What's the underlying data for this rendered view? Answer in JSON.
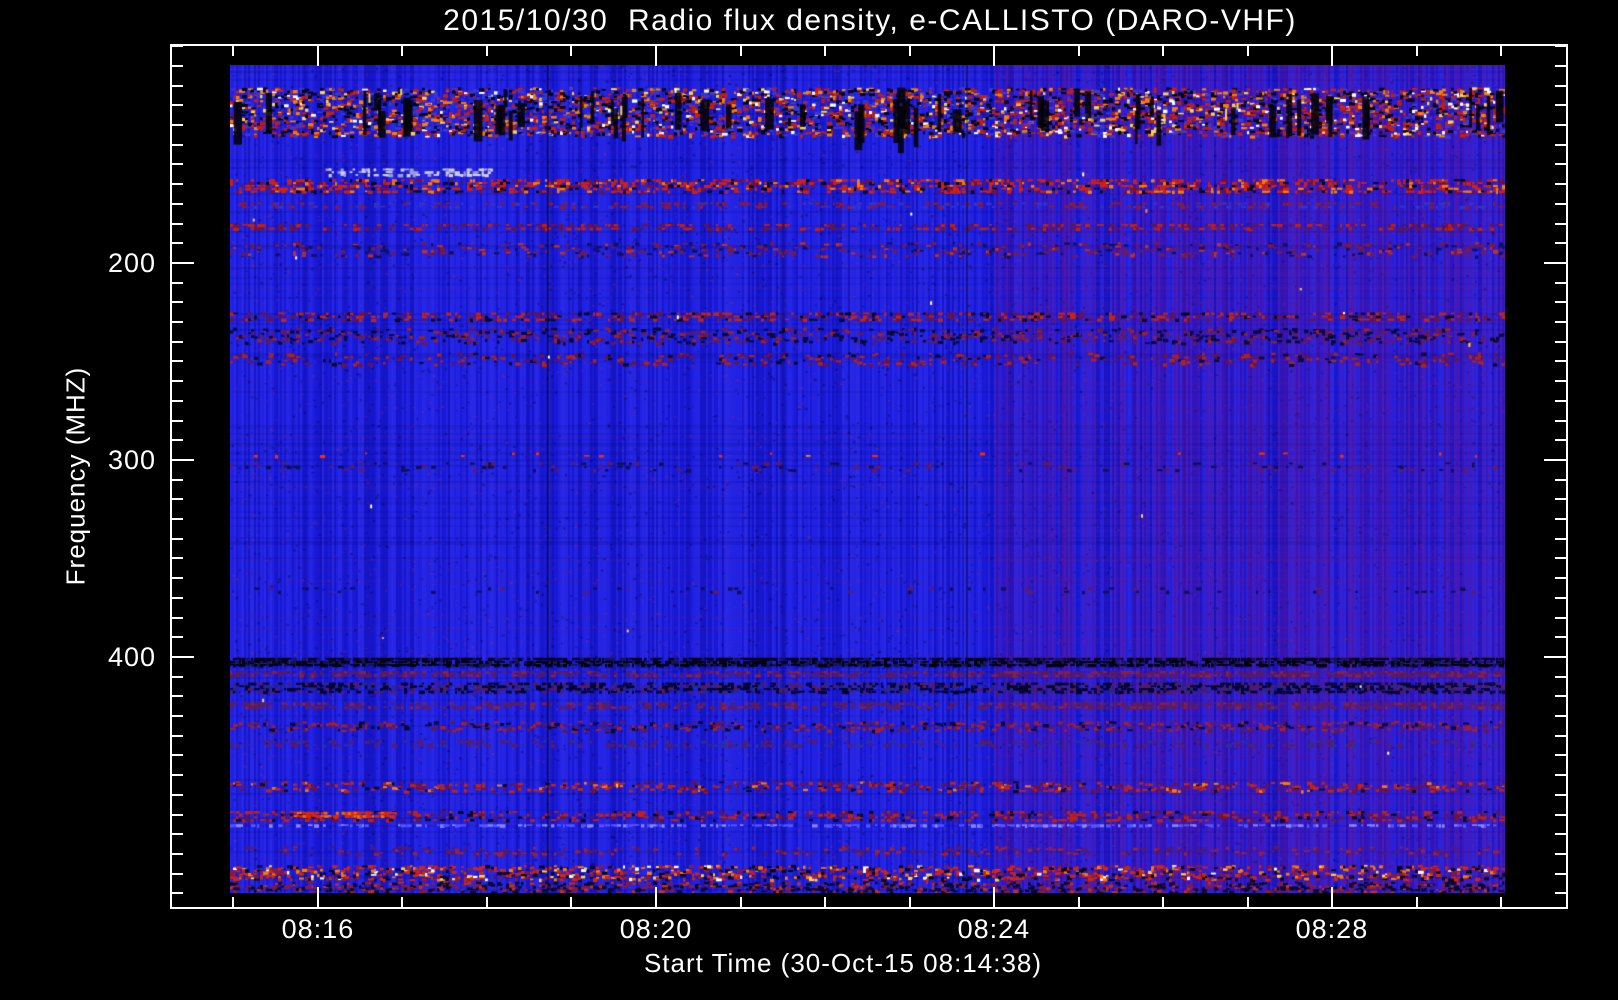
{
  "chart_data": {
    "type": "heatmap",
    "title": "2015/10/30  Radio flux density, e-CALLISTO (DARO-VHF)",
    "xlabel": "Start Time (30-Oct-15 08:14:38)",
    "ylabel": "Frequency (MHZ)",
    "start_time": "08:14:38",
    "date": "2015/10/30",
    "instrument": "e-CALLISTO (DARO-VHF)",
    "freq_range_mhz": [
      98,
      518
    ],
    "freq_axis_inverted": true,
    "x_axis": {
      "major_ticks": [
        {
          "label": "08:16",
          "frac": 0.1047
        },
        {
          "label": "08:20",
          "frac": 0.3472
        },
        {
          "label": "08:24",
          "frac": 0.5896
        },
        {
          "label": "08:28",
          "frac": 0.8321
        }
      ],
      "minor_start_frac": 0.0441,
      "minor_step_frac": 0.06062,
      "minor_count": 16,
      "minor_interval": "1 min"
    },
    "y_axis": {
      "major_ticks": [
        {
          "label": "200",
          "frac": 0.252
        },
        {
          "label": "300",
          "frac": 0.4808
        },
        {
          "label": "400",
          "frac": 0.7096
        }
      ],
      "minor_start_frac": 0.0003,
      "minor_step_frac": 0.02288,
      "minor_count": 44,
      "minor_interval": "10 MHz"
    },
    "colors": {
      "background": "#000000",
      "axis": "#ffffff",
      "base_blue": "#1c1ce0",
      "purple": "#5a1e8c",
      "band_red": "#c82010",
      "orange": "#ff7a00",
      "yellow": "#ffd24a",
      "dark": "#03031a",
      "white": "#ffffff"
    },
    "regimes": {
      "description": "background regime change at 08:24 - right side purple-tinted with vertical striping",
      "purple_start_frac": 0.6008,
      "purple_rgb": "110,20,140"
    },
    "vertical_lines": [
      {
        "frac": 0.2486,
        "alpha": 0.5
      },
      {
        "frac": 0.433,
        "alpha": 0.22
      },
      {
        "frac": 0.5773,
        "alpha": 0.42
      }
    ],
    "noise": {
      "sparkles": 22,
      "pixel_noise": 9000
    },
    "bands": [
      {
        "name": "aviation-rfi-top",
        "freq_mhz": [
          109,
          135
        ],
        "y": 0.027,
        "h": 0.06,
        "density": 0.55,
        "mode": "speckle",
        "palette": [
          [
            "#c81e0a",
            0.3
          ],
          [
            "#ff7d00",
            0.14
          ],
          [
            "#ffd24a",
            0.06
          ],
          [
            "#05050f",
            0.26
          ],
          [
            "#3a3ad0",
            0.18
          ],
          [
            "#ffffff",
            0.06
          ]
        ],
        "black_bars": 60,
        "bright_cols": 12
      },
      {
        "name": "white-dash-row",
        "freq_mhz": [
          151,
          154
        ],
        "y": 0.125,
        "h": 0.01,
        "density": 0.45,
        "mode": "dash",
        "x0": 0.075,
        "x1": 0.206,
        "palette": [
          [
            "#cfcfe8",
            0.7
          ],
          [
            "#9a9ad8",
            0.3
          ]
        ]
      },
      {
        "name": "red-dash-band",
        "freq_mhz": [
          156,
          162
        ],
        "y": 0.138,
        "h": 0.017,
        "density": 0.42,
        "mode": "dash",
        "palette": [
          [
            "#d2200e",
            0.52
          ],
          [
            "#ff7a00",
            0.16
          ],
          [
            "#7a1030",
            0.16
          ],
          [
            "#05051a",
            0.16
          ]
        ]
      },
      {
        "name": "faint-red-row",
        "freq_mhz": [
          168,
          170
        ],
        "y": 0.166,
        "h": 0.008,
        "density": 0.28,
        "mode": "dash",
        "palette": [
          [
            "#8a1a3a",
            0.6
          ],
          [
            "#3333cc",
            0.4
          ]
        ]
      },
      {
        "name": "red-row-179",
        "freq_mhz": [
          178,
          181
        ],
        "y": 0.192,
        "h": 0.009,
        "density": 0.33,
        "mode": "dash",
        "palette": [
          [
            "#c02010",
            0.5
          ],
          [
            "#6a1440",
            0.5
          ]
        ]
      },
      {
        "name": "noise-band-188",
        "freq_mhz": [
          185,
          193
        ],
        "y": 0.214,
        "h": 0.018,
        "density": 0.22,
        "mode": "speckle",
        "palette": [
          [
            "#7a1a40",
            0.45
          ],
          [
            "#101060",
            0.3
          ],
          [
            "#c03020",
            0.25
          ]
        ]
      },
      {
        "name": "red-band-224",
        "freq_mhz": [
          224,
          228
        ],
        "y": 0.299,
        "h": 0.011,
        "density": 0.38,
        "mode": "dash",
        "palette": [
          [
            "#c02515",
            0.45
          ],
          [
            "#70123a",
            0.3
          ],
          [
            "#08081f",
            0.25
          ]
        ]
      },
      {
        "name": "dark-smudge-232",
        "freq_mhz": [
          230,
          238
        ],
        "y": 0.317,
        "h": 0.02,
        "density": 0.3,
        "mode": "speckle",
        "palette": [
          [
            "#0a0a35",
            0.5
          ],
          [
            "#6a1a50",
            0.3
          ],
          [
            "#a02020",
            0.2
          ]
        ]
      },
      {
        "name": "red-band-244",
        "freq_mhz": [
          244,
          250
        ],
        "y": 0.347,
        "h": 0.016,
        "density": 0.22,
        "mode": "speckle",
        "palette": [
          [
            "#b02218",
            0.45
          ],
          [
            "#70123a",
            0.35
          ],
          [
            "#0a0a30",
            0.2
          ]
        ]
      },
      {
        "name": "dot-row-295",
        "freq_mhz": [
          295,
          297
        ],
        "y": 0.468,
        "h": 0.006,
        "density": 0.02,
        "mode": "dash",
        "palette": [
          [
            "#ff2a00",
            0.8
          ],
          [
            "#ff8800",
            0.2
          ]
        ]
      },
      {
        "name": "faint-row-300",
        "freq_mhz": [
          300,
          305
        ],
        "y": 0.48,
        "h": 0.012,
        "density": 0.1,
        "mode": "dash",
        "palette": [
          [
            "#101055",
            0.6
          ],
          [
            "#6a1a50",
            0.4
          ]
        ]
      },
      {
        "name": "faint-row-364",
        "freq_mhz": [
          364,
          367
        ],
        "y": 0.631,
        "h": 0.008,
        "density": 0.08,
        "mode": "dash",
        "palette": [
          [
            "#101055",
            0.7
          ],
          [
            "#6a1a50",
            0.3
          ]
        ]
      },
      {
        "name": "dark-band-400",
        "freq_mhz": [
          400,
          404
        ],
        "y": 0.716,
        "h": 0.011,
        "density": 0.85,
        "mode": "dash",
        "palette": [
          [
            "#02020f",
            0.75
          ],
          [
            "#15154f",
            0.25
          ]
        ]
      },
      {
        "name": "maroon-row-407",
        "freq_mhz": [
          406,
          409
        ],
        "y": 0.732,
        "h": 0.008,
        "density": 0.5,
        "right_mult": 1.5,
        "mode": "dash",
        "palette": [
          [
            "#5c1a5a",
            0.7
          ],
          [
            "#8a2040",
            0.3
          ]
        ]
      },
      {
        "name": "dark-dash-414",
        "freq_mhz": [
          412,
          417
        ],
        "y": 0.746,
        "h": 0.013,
        "density": 0.55,
        "right_mult": 1.3,
        "mode": "dash",
        "palette": [
          [
            "#05052a",
            0.6
          ],
          [
            "#2a2a80",
            0.2
          ],
          [
            "#5c1a5a",
            0.2
          ]
        ]
      },
      {
        "name": "maroon-row-423",
        "freq_mhz": [
          422,
          425
        ],
        "y": 0.77,
        "h": 0.009,
        "density": 0.45,
        "right_mult": 1.5,
        "mode": "dash",
        "palette": [
          [
            "#601c55",
            0.75
          ],
          [
            "#8a2040",
            0.25
          ]
        ]
      },
      {
        "name": "red-noise-434",
        "freq_mhz": [
          432,
          437
        ],
        "y": 0.792,
        "h": 0.013,
        "density": 0.3,
        "mode": "speckle",
        "palette": [
          [
            "#a02030",
            0.4
          ],
          [
            "#5c1a5a",
            0.35
          ],
          [
            "#0a0a30",
            0.25
          ]
        ]
      },
      {
        "name": "maroon-row-442",
        "freq_mhz": [
          440,
          443
        ],
        "y": 0.816,
        "h": 0.009,
        "density": 0.3,
        "mode": "dash",
        "palette": [
          [
            "#601c55",
            0.7
          ],
          [
            "#30308a",
            0.3
          ]
        ]
      },
      {
        "name": "red-band-464",
        "freq_mhz": [
          462,
          467
        ],
        "y": 0.865,
        "h": 0.013,
        "density": 0.28,
        "mode": "speckle",
        "palette": [
          [
            "#c02515",
            0.5
          ],
          [
            "#70123a",
            0.3
          ],
          [
            "#ff7a00",
            0.1
          ],
          [
            "#0a0a30",
            0.1
          ]
        ]
      },
      {
        "name": "red-dash-479",
        "freq_mhz": [
          477,
          482
        ],
        "y": 0.901,
        "h": 0.013,
        "density": 0.3,
        "mode": "dash",
        "palette": [
          [
            "#c22010",
            0.55
          ],
          [
            "#70123a",
            0.25
          ],
          [
            "#08081f",
            0.2
          ]
        ]
      },
      {
        "name": "red-dash-479-strong",
        "freq_mhz": [
          478,
          480
        ],
        "y": 0.902,
        "h": 0.008,
        "density": 0.85,
        "mode": "dash",
        "x0": 0.05,
        "x1": 0.13,
        "palette": [
          [
            "#e02800",
            0.7
          ],
          [
            "#ff6a00",
            0.3
          ]
        ]
      },
      {
        "name": "pale-row-485",
        "freq_mhz": [
          484,
          486
        ],
        "y": 0.917,
        "h": 0.004,
        "density": 0.5,
        "mode": "dash",
        "palette": [
          [
            "#5555ff",
            0.6
          ],
          [
            "#8888ff",
            0.4
          ]
        ]
      },
      {
        "name": "faint-band-496",
        "freq_mhz": [
          494,
          499
        ],
        "y": 0.943,
        "h": 0.011,
        "density": 0.18,
        "mode": "speckle",
        "palette": [
          [
            "#a02030",
            0.5
          ],
          [
            "#5c1a5a",
            0.5
          ]
        ]
      },
      {
        "name": "red-strong-bottom",
        "freq_mhz": [
          505,
          512
        ],
        "y": 0.966,
        "h": 0.019,
        "density": 0.5,
        "mode": "speckle",
        "palette": [
          [
            "#d02510",
            0.4
          ],
          [
            "#ff7a00",
            0.12
          ],
          [
            "#8a1a3a",
            0.2
          ],
          [
            "#05051a",
            0.2
          ],
          [
            "#ffd24a",
            0.04
          ],
          [
            "#ffffff",
            0.04
          ]
        ]
      },
      {
        "name": "bottom-dark-rows",
        "freq_mhz": [
          512,
          516
        ],
        "y": 0.986,
        "h": 0.014,
        "density": 0.5,
        "mode": "speckle",
        "palette": [
          [
            "#0a0a28",
            0.5
          ],
          [
            "#8a1a3a",
            0.3
          ],
          [
            "#c03020",
            0.2
          ]
        ]
      }
    ]
  }
}
